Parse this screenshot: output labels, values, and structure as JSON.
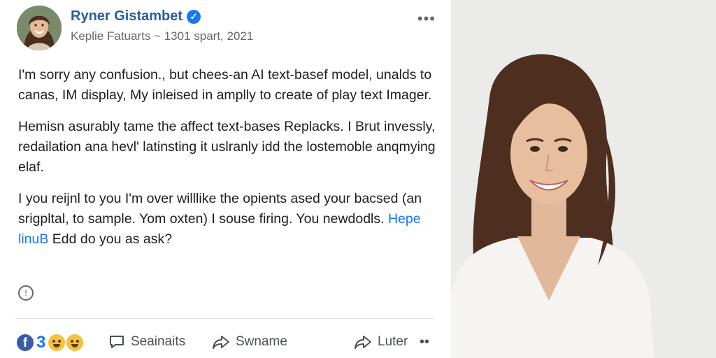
{
  "post": {
    "author": "Ryner Gistambet",
    "meta": "Keplie Fatuarts ~ 1301 spart, 2021",
    "paragraphs": [
      "I'm sorry any confusion., but chees-an AI text-basef model, unalds to canas, IM display, My inleised in amplly to create of play text Imager.",
      "Hemisn asurably tame the affect text-bases Replacks. I Brut invessly, redailation ana hevl' latinsting it uslranly idd the lostemoble anqmying elaf.",
      "I you reijnl to you I'm over willlike the opients ased your bacsed (an srigpltal, to sample. Yom oxten) I souse firing. You newdodls."
    ],
    "link_text": "Hepe linuB",
    "after_link": " Edd do you as ask?"
  },
  "reactions": {
    "count": "3"
  },
  "actions": {
    "comment": "Seainaits",
    "share": "Swname",
    "send": "Luter"
  },
  "icons": {
    "more": "more-horizontal-icon",
    "verified": "verified-check-icon",
    "clock": "clock-icon",
    "comment": "comment-icon",
    "share": "share-arrow-icon",
    "send": "send-arrow-icon"
  },
  "colors": {
    "author": "#2a5e9c",
    "link": "#1877f2",
    "verified": "#1877f2",
    "count": "#1877f2"
  }
}
